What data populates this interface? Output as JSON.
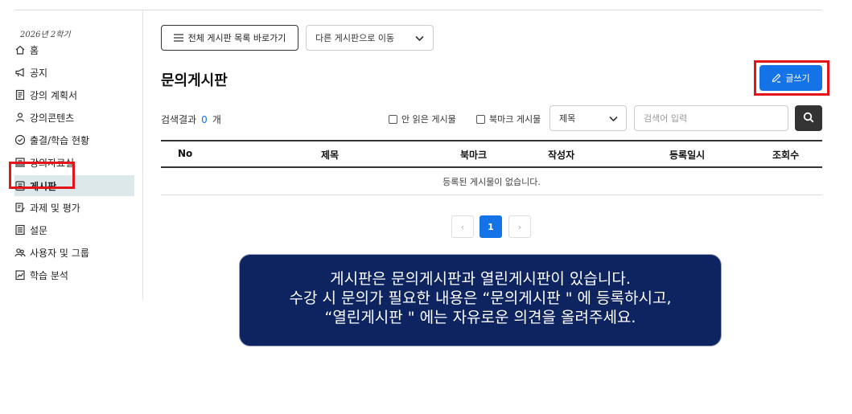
{
  "sidebar": {
    "semester": "2026년 2학기",
    "items": [
      {
        "label": "홈",
        "icon": "home-icon"
      },
      {
        "label": "공지",
        "icon": "megaphone-icon"
      },
      {
        "label": "강의 계획서",
        "icon": "document-icon"
      },
      {
        "label": "강의콘텐츠",
        "icon": "content-icon"
      },
      {
        "label": "출결/학습 현황",
        "icon": "check-circle-icon"
      },
      {
        "label": "강의자료실",
        "icon": "archive-icon"
      },
      {
        "label": "게시판",
        "icon": "board-icon"
      },
      {
        "label": "과제 및 평가",
        "icon": "assignment-icon"
      },
      {
        "label": "설문",
        "icon": "survey-icon"
      },
      {
        "label": "사용자 및 그룹",
        "icon": "users-icon"
      },
      {
        "label": "학습 분석",
        "icon": "analytics-icon"
      }
    ],
    "active": "게시판"
  },
  "toolbar": {
    "list_button": "전체 게시판 목록 바로가기",
    "move_select": "다른 게시판으로 이동"
  },
  "page": {
    "title": "문의게시판",
    "write_button": "글쓰기"
  },
  "search": {
    "result_label": "검색결과",
    "result_count": "0",
    "result_unit": "개",
    "unread_label": "안 읽은 게시물",
    "bookmark_label": "북마크 게시물",
    "field_select": "제목",
    "placeholder": "검색어 입력"
  },
  "table": {
    "columns": [
      "No",
      "제목",
      "북마크",
      "작성자",
      "등록일시",
      "조회수"
    ],
    "empty_message": "등록된 게시물이 없습니다."
  },
  "pagination": {
    "prev": "‹",
    "current": "1",
    "next": "›"
  },
  "note": {
    "lines": [
      "게시판은 문의게시판과 열린게시판이 있습니다.",
      "수강 시 문의가 필요한 내용은 “문의게시판 \" 에 등록하시고,",
      "“열린게시판 \" 에는 자유로운 의견을 올려주세요."
    ]
  },
  "colors": {
    "accent": "#1473e6",
    "highlight": "#e3151a",
    "note_bg": "#0d2460",
    "active_bg": "#dde8ea"
  }
}
